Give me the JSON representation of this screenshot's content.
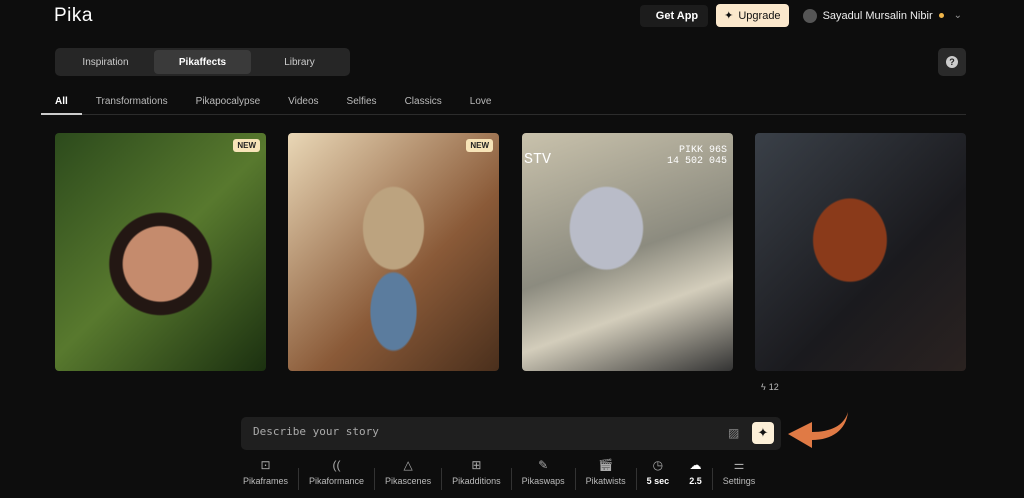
{
  "header": {
    "logo": "Pika",
    "get_app": "Get App",
    "upgrade": "Upgrade",
    "user_name": "Sayadul Mursalin Nibir"
  },
  "main_tabs": [
    {
      "label": "Inspiration"
    },
    {
      "label": "Pikaffects",
      "active": true
    },
    {
      "label": "Library"
    }
  ],
  "help_label": "?",
  "categories": [
    {
      "label": "All",
      "active": true
    },
    {
      "label": "Transformations"
    },
    {
      "label": "Pikapocalypse"
    },
    {
      "label": "Videos"
    },
    {
      "label": "Selfies"
    },
    {
      "label": "Classics"
    },
    {
      "label": "Love"
    }
  ],
  "gallery": [
    {
      "badge": "NEW"
    },
    {
      "badge": "NEW"
    },
    {
      "overlay_left": "STV",
      "overlay_right": "PIKK 96S\n14 502 045"
    },
    {
      "likes": "12"
    }
  ],
  "prompt": {
    "placeholder": "Describe your story"
  },
  "toolbar": [
    {
      "label": "Pikaframes",
      "icon": "frames-icon"
    },
    {
      "label": "Pikaformance",
      "icon": "performance-icon"
    },
    {
      "label": "Pikascenes",
      "icon": "shapes-icon"
    },
    {
      "label": "Pikadditions",
      "icon": "add-icon"
    },
    {
      "label": "Pikaswaps",
      "icon": "swap-brush-icon"
    },
    {
      "label": "Pikatwists",
      "icon": "clapper-icon"
    },
    {
      "label": "5 sec",
      "icon": "clock-icon"
    },
    {
      "label": "2.5",
      "icon": "model-icon"
    },
    {
      "label": "Settings",
      "icon": "sliders-icon"
    }
  ],
  "colors": {
    "background": "#0d0d0d",
    "accent": "#fbe8cc",
    "arrow": "#e07a45",
    "status_dot": "#f0b64a"
  }
}
